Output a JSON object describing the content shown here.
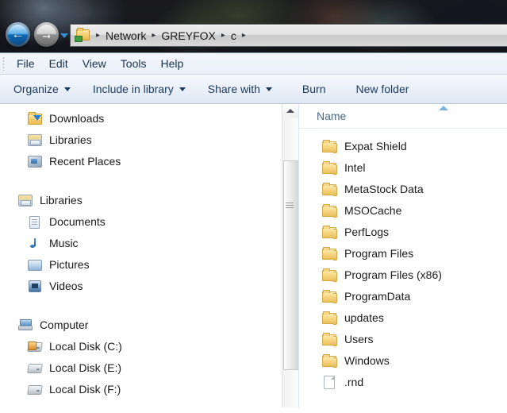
{
  "nav": {
    "back_label": "←",
    "forward_label": "→",
    "back_name": "Back",
    "forward_name": "Forward",
    "history_label": "Recent pages",
    "breadcrumb": [
      "Network",
      "GREYFOX",
      "c"
    ],
    "separator": "▸"
  },
  "menu": {
    "items": [
      "File",
      "Edit",
      "View",
      "Tools",
      "Help"
    ]
  },
  "toolbar": {
    "items": [
      {
        "label": "Organize",
        "caret": true
      },
      {
        "label": "Include in library",
        "caret": true
      },
      {
        "label": "Share with",
        "caret": true
      },
      {
        "label": "Burn",
        "caret": false
      },
      {
        "label": "New folder",
        "caret": false
      }
    ]
  },
  "sidebar": {
    "groups": [
      {
        "name": "favorites-tail",
        "items": [
          {
            "label": "Downloads",
            "icon": "downloads-folder-icon",
            "level": 1
          },
          {
            "label": "Libraries",
            "icon": "libraries-icon",
            "level": 1
          },
          {
            "label": "Recent Places",
            "icon": "recent-places-icon",
            "level": 1
          }
        ]
      },
      {
        "name": "libraries",
        "items": [
          {
            "label": "Libraries",
            "icon": "libraries-icon",
            "level": 0
          },
          {
            "label": "Documents",
            "icon": "documents-icon",
            "level": 1
          },
          {
            "label": "Music",
            "icon": "music-icon",
            "level": 1
          },
          {
            "label": "Pictures",
            "icon": "pictures-icon",
            "level": 1
          },
          {
            "label": "Videos",
            "icon": "videos-icon",
            "level": 1
          }
        ]
      },
      {
        "name": "computer",
        "items": [
          {
            "label": "Computer",
            "icon": "computer-icon",
            "level": 0
          },
          {
            "label": "Local Disk (C:)",
            "icon": "system-drive-icon",
            "level": 1
          },
          {
            "label": "Local Disk (E:)",
            "icon": "drive-icon",
            "level": 1
          },
          {
            "label": "Local Disk (F:)",
            "icon": "drive-icon",
            "level": 1
          }
        ]
      }
    ],
    "scrollbar": {
      "up_arrow": "▲"
    }
  },
  "filelist": {
    "column_header": "Name",
    "sort_direction": "ascending",
    "rows": [
      {
        "name": "Expat Shield",
        "type": "folder"
      },
      {
        "name": "Intel",
        "type": "folder"
      },
      {
        "name": "MetaStock Data",
        "type": "folder"
      },
      {
        "name": "MSOCache",
        "type": "folder"
      },
      {
        "name": "PerfLogs",
        "type": "folder"
      },
      {
        "name": "Program Files",
        "type": "folder"
      },
      {
        "name": "Program Files (x86)",
        "type": "folder"
      },
      {
        "name": "ProgramData",
        "type": "folder"
      },
      {
        "name": "updates",
        "type": "folder"
      },
      {
        "name": "Users",
        "type": "folder"
      },
      {
        "name": "Windows",
        "type": "folder"
      },
      {
        "name": ".rnd",
        "type": "file"
      }
    ]
  },
  "colors": {
    "toolbar_text": "#1b3a5c",
    "menu_text": "#16324f",
    "column_header_text": "#4a6782",
    "sort_arrow": "#7fb2dd",
    "folder_yellow": "#f8d884"
  }
}
